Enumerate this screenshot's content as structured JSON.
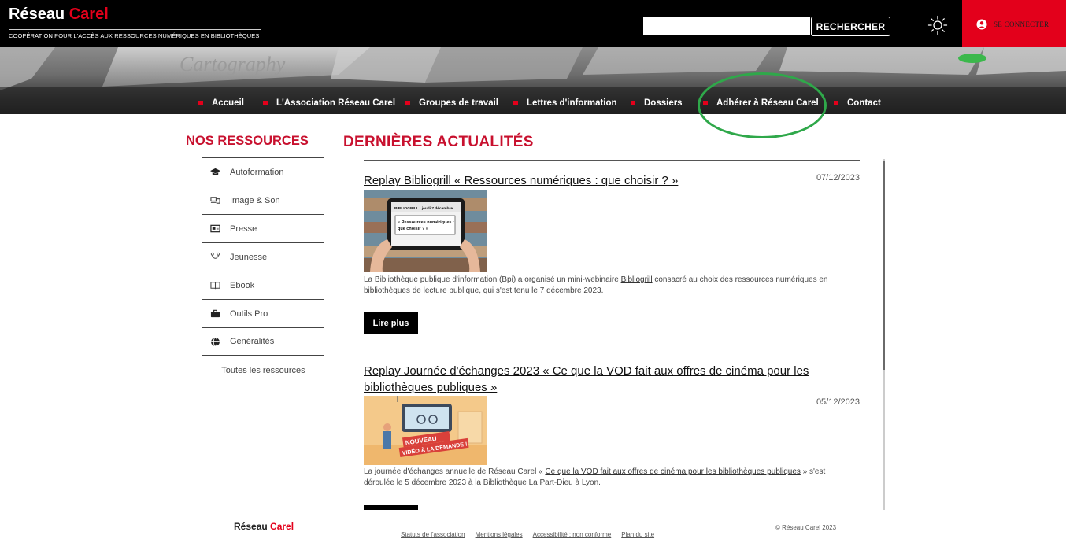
{
  "header": {
    "brand_main": "Réseau",
    "brand_accent": "Carel",
    "tagline": "COOPÉRATION POUR L'ACCÈS AUX RESSOURCES NUMÉRIQUES EN BIBLIOTHÈQUES",
    "search_placeholder": "",
    "search_button": "RECHERCHER",
    "login_label": "SE CONNECTER"
  },
  "banner": {
    "background_word": "Cartography"
  },
  "nav": {
    "items": [
      {
        "label": "Accueil"
      },
      {
        "label": "L'Association Réseau Carel"
      },
      {
        "label": "Groupes de travail"
      },
      {
        "label": "Lettres d'information"
      },
      {
        "label": "Dossiers"
      },
      {
        "label": "Adhérer à Réseau Carel"
      },
      {
        "label": "Contact"
      }
    ]
  },
  "sidebar": {
    "title": "NOS RESSOURCES",
    "items": [
      {
        "label": "Autoformation",
        "icon": "graduation-cap-icon"
      },
      {
        "label": "Image & Son",
        "icon": "film-icon"
      },
      {
        "label": "Presse",
        "icon": "newspaper-icon"
      },
      {
        "label": "Jeunesse",
        "icon": "toy-icon"
      },
      {
        "label": "Ebook",
        "icon": "book-icon"
      },
      {
        "label": "Outils Pro",
        "icon": "briefcase-icon"
      },
      {
        "label": "Généralités",
        "icon": "globe-icon"
      }
    ],
    "all_label": "Toutes les ressources"
  },
  "main": {
    "title": "DERNIÈRES ACTUALITÉS",
    "articles": [
      {
        "title": "Replay Bibliogrill « Ressources numériques : que choisir ? »",
        "date": "07/12/2023",
        "thumb_line1": "BIBLIOGRILL · jeudi 7 décembre",
        "thumb_line2": "« Ressources numériques :",
        "thumb_line3": "que choisir ? »",
        "text_before": "La Bibliothèque publique d'information (Bpi) a organisé un mini-webinaire ",
        "text_link": "Bibliogrill",
        "text_after": " consacré au choix des ressources numériques en bibliothèques de lecture publique, qui s'est tenu le 7 décembre 2023.",
        "read_more": "Lire plus"
      },
      {
        "title": "Replay Journée d'échanges 2023 « Ce que la VOD fait aux offres de cinéma pour les bibliothèques publiques »",
        "date": "05/12/2023",
        "thumb_line1": "NOUVEAU",
        "thumb_line2": "VIDÉO À LA DEMANDE !",
        "text_before": "La journée d'échanges annuelle de Réseau Carel « ",
        "text_link": "Ce que la VOD fait aux offres de cinéma pour les bibliothèques publiques",
        "text_after": " » s'est déroulée le 5 décembre 2023 à la Bibliothèque La Part-Dieu à Lyon."
      }
    ]
  },
  "footer": {
    "brand_main": "Réseau",
    "brand_accent": "Carel",
    "links": [
      "Statuts de l'association",
      "Mentions légales",
      "Accessibilité : non conforme",
      "Plan du site"
    ],
    "copyright": "© Réseau Carel 2023"
  },
  "colors": {
    "accent_red": "#e3001b",
    "title_red": "#c8102e",
    "highlight_circle": "#2fa84a"
  }
}
